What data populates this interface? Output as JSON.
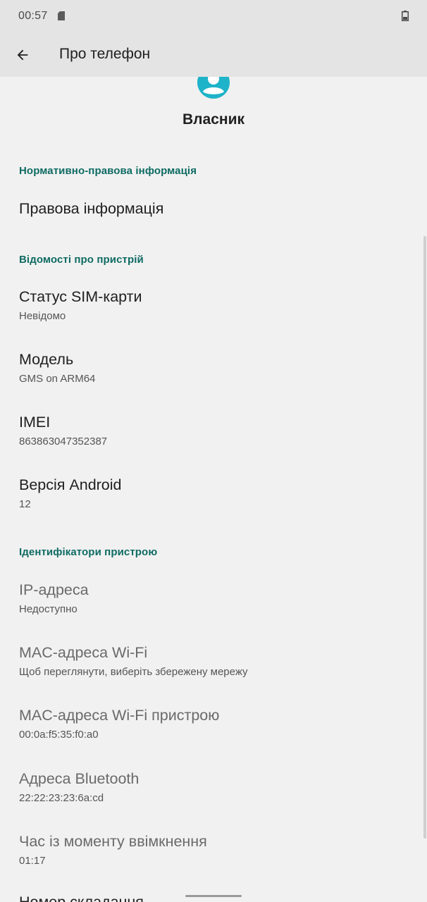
{
  "status_bar": {
    "time": "00:57",
    "icons": [
      "sd-card-icon",
      "battery-icon"
    ]
  },
  "app_bar": {
    "back_icon": "arrow-back-icon",
    "title": "Про телефон"
  },
  "owner": {
    "avatar_icon": "account-circle-icon",
    "name": "Власник"
  },
  "sections": {
    "regulatory": {
      "header": "Нормативно-правова інформація",
      "legal_info": "Правова інформація"
    },
    "device_info": {
      "header": "Відомості про пристрій",
      "sim_status": {
        "title": "Статус SIM-карти",
        "value": "Невідомо"
      },
      "model": {
        "title": "Модель",
        "value": "GMS on ARM64"
      },
      "imei": {
        "title": "IMEI",
        "value": "863863047352387"
      },
      "android_version": {
        "title": "Версія Android",
        "value": "12"
      }
    },
    "device_identifiers": {
      "header": "Ідентифікатори пристрою",
      "ip_address": {
        "title": "IP-адреса",
        "value": "Недоступно"
      },
      "wifi_mac": {
        "title": "MAC-адреса Wi-Fi",
        "value": "Щоб переглянути, виберіть збережену мережу"
      },
      "wifi_device_mac": {
        "title": "MAC-адреса Wi-Fi пристрою",
        "value": "00:0a:f5:35:f0:a0"
      },
      "bluetooth_address": {
        "title": "Адреса Bluetooth",
        "value": "22:22:23:23:6a:cd"
      },
      "uptime": {
        "title": "Час із моменту ввімкнення",
        "value": "01:17"
      },
      "build_number_partial": "Номер складання"
    }
  },
  "colors": {
    "accent": "#0e6b63",
    "avatar": "#1fb3c9",
    "background": "#f1f1f1",
    "app_bar": "#e4e4e4"
  }
}
